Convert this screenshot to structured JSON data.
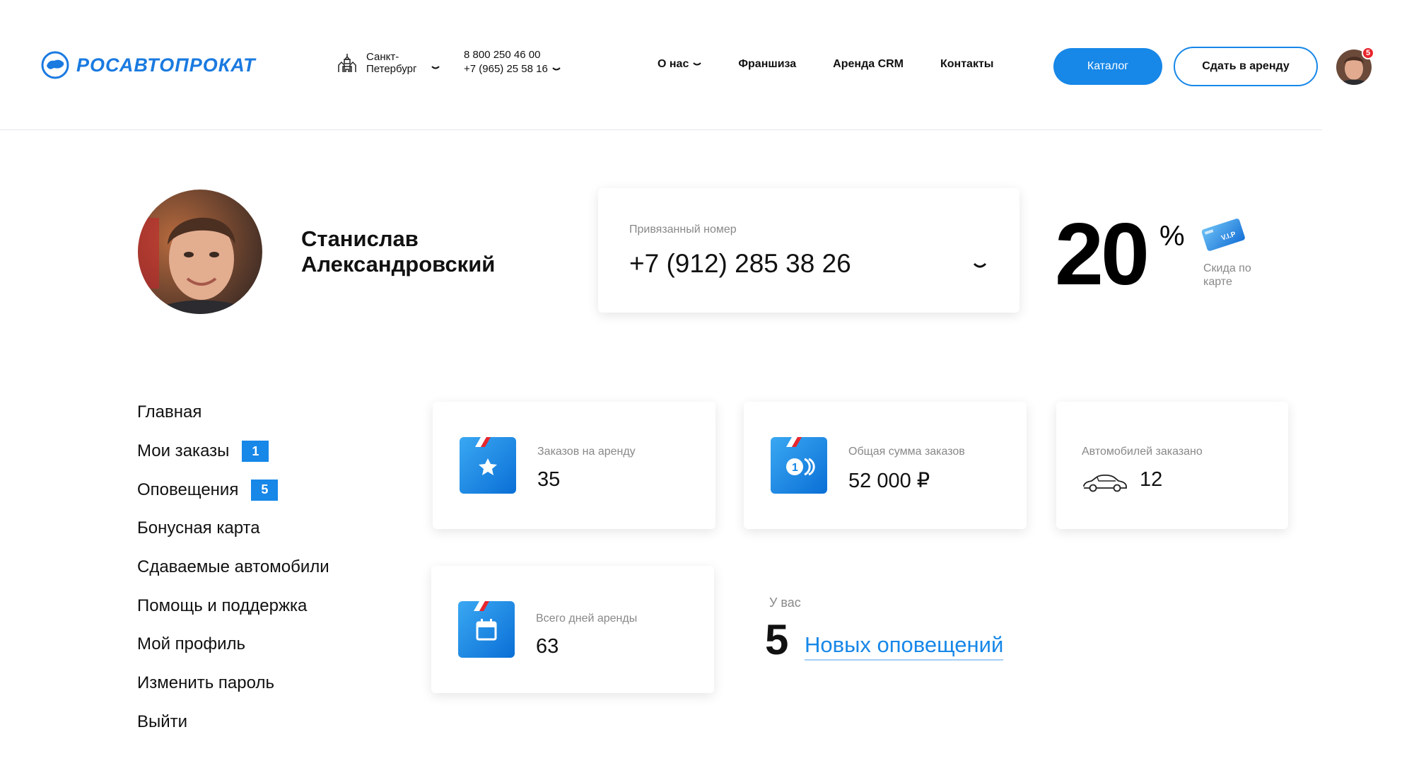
{
  "header": {
    "logo_text": "РОСАВТОПРОКАТ",
    "city": "Санкт-Петербург",
    "phones": [
      "8 800 250 46 00",
      "+7 (965) 25 58 16"
    ],
    "nav": [
      "О нас",
      "Франшиза",
      "Аренда CRM",
      "Контакты"
    ],
    "catalog_button": "Каталог",
    "rent_out_button": "Сдать в аренду",
    "notifications_badge": "5"
  },
  "profile": {
    "name": "Станислав Александровский",
    "linked_phone_label": "Привязанный номер",
    "linked_phone": "+7 (912) 285 38 26",
    "discount_value": "20",
    "discount_unit": "%",
    "discount_label": "Скида по карте",
    "vip_card_text": "V.I.P"
  },
  "side_menu": [
    {
      "label": "Главная",
      "badge": null
    },
    {
      "label": "Мои заказы",
      "badge": "1"
    },
    {
      "label": "Оповещения",
      "badge": "5"
    },
    {
      "label": "Бонусная карта",
      "badge": null
    },
    {
      "label": "Сдаваемые автомобили",
      "badge": null
    },
    {
      "label": "Помощь и поддержка",
      "badge": null
    },
    {
      "label": "Мой профиль",
      "badge": null
    },
    {
      "label": "Изменить пароль",
      "badge": null
    },
    {
      "label": "Выйти",
      "badge": null
    }
  ],
  "stats": {
    "rent_orders": {
      "label": "Заказов на аренду",
      "value": "35",
      "icon": "star-icon"
    },
    "total_sum": {
      "label": "Общая сумма заказов",
      "value": "52 000 ₽",
      "icon": "coins-icon"
    },
    "cars_ordered": {
      "label": "Автомобилей заказано",
      "value": "12",
      "icon": "car-icon"
    },
    "rent_days": {
      "label": "Всего дней аренды",
      "value": "63",
      "icon": "calendar-icon"
    }
  },
  "notifications": {
    "caption": "У вас",
    "count": "5",
    "link": "Новых оповещений"
  },
  "colors": {
    "accent": "#1787e8",
    "badge_red": "#e8262c",
    "text": "#111111",
    "muted": "#888888"
  }
}
